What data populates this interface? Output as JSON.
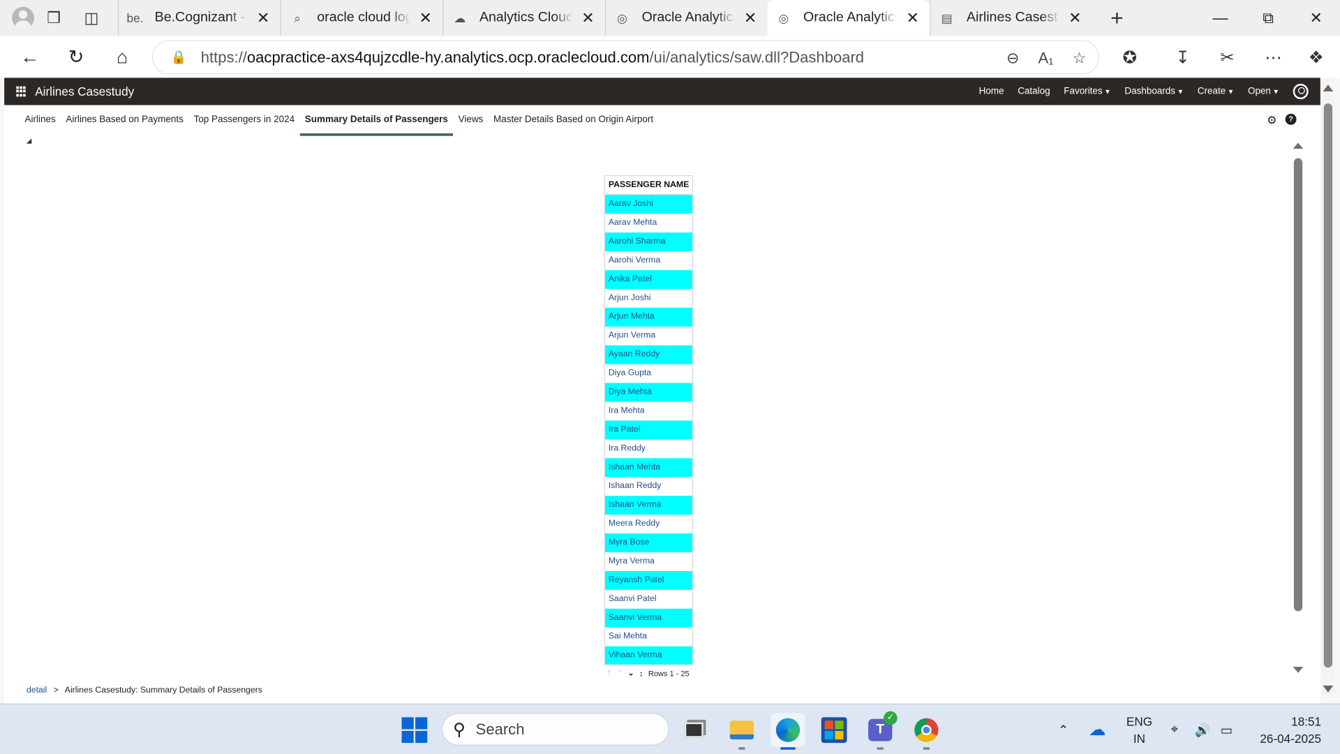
{
  "browser": {
    "tabs": [
      {
        "favicon": "be.",
        "title": "Be.Cognizant - Ho",
        "active": false
      },
      {
        "favicon": "search",
        "title": "oracle cloud login",
        "active": false
      },
      {
        "favicon": "cloud",
        "title": "Analytics Cloud | O",
        "active": false
      },
      {
        "favicon": "globe",
        "title": "Oracle Analytics",
        "active": false
      },
      {
        "favicon": "globe",
        "title": "Oracle Analytics In",
        "active": true
      },
      {
        "favicon": "pdf",
        "title": "Airlines Casestudy",
        "active": false
      }
    ],
    "url_prefix": "https://",
    "url_host": "oacpractice-axs4qujzcdle-hy.analytics.ocp.oraclecloud.com",
    "url_path": "/ui/analytics/saw.dll?Dashboard"
  },
  "oac": {
    "app_title": "Airlines Casestudy",
    "menu": [
      {
        "label": "Home",
        "dropdown": false
      },
      {
        "label": "Catalog",
        "dropdown": false
      },
      {
        "label": "Favorites",
        "dropdown": true
      },
      {
        "label": "Dashboards",
        "dropdown": true
      },
      {
        "label": "Create",
        "dropdown": true
      },
      {
        "label": "Open",
        "dropdown": true
      }
    ]
  },
  "dashboard": {
    "pages": [
      {
        "label": "Airlines",
        "active": false
      },
      {
        "label": "Airlines Based on Payments",
        "active": false
      },
      {
        "label": "Top Passengers in 2024",
        "active": false
      },
      {
        "label": "Summary Details of Passengers",
        "active": true
      },
      {
        "label": "Views",
        "active": false
      },
      {
        "label": "Master Details Based on Origin Airport",
        "active": false
      }
    ]
  },
  "table": {
    "header": "PASSENGER NAME",
    "rows": [
      "Aarav Joshi",
      "Aarav Mehta",
      "Aarohi Sharma",
      "Aarohi Verma",
      "Anika Patel",
      "Arjun Joshi",
      "Arjun Mehta",
      "Arjun Verma",
      "Ayaan Reddy",
      "Diya Gupta",
      "Diya Mehta",
      "Ira Mehta",
      "Ira Patel",
      "Ira Reddy",
      "Ishaan Mehta",
      "Ishaan Reddy",
      "Ishaan Verma",
      "Meera Reddy",
      "Myra Bose",
      "Myra Verma",
      "Reyansh Patel",
      "Saanvi Patel",
      "Saanvi Verma",
      "Sai Mehta",
      "Vihaan Verma"
    ],
    "highlight_color": "#00ffff",
    "rows_label": "Rows 1 - 25"
  },
  "breadcrumb": {
    "link": "detail",
    "separator": ">",
    "current": "Airlines Casestudy: Summary Details of Passengers"
  },
  "taskbar": {
    "search_label": "Search",
    "lang_top": "ENG",
    "lang_bottom": "IN",
    "time": "18:51",
    "date": "26-04-2025"
  },
  "colors": {
    "oac_header_bg": "#2c2826",
    "active_tab_underline": "#3d6b4f",
    "link": "#1f4f8a"
  }
}
